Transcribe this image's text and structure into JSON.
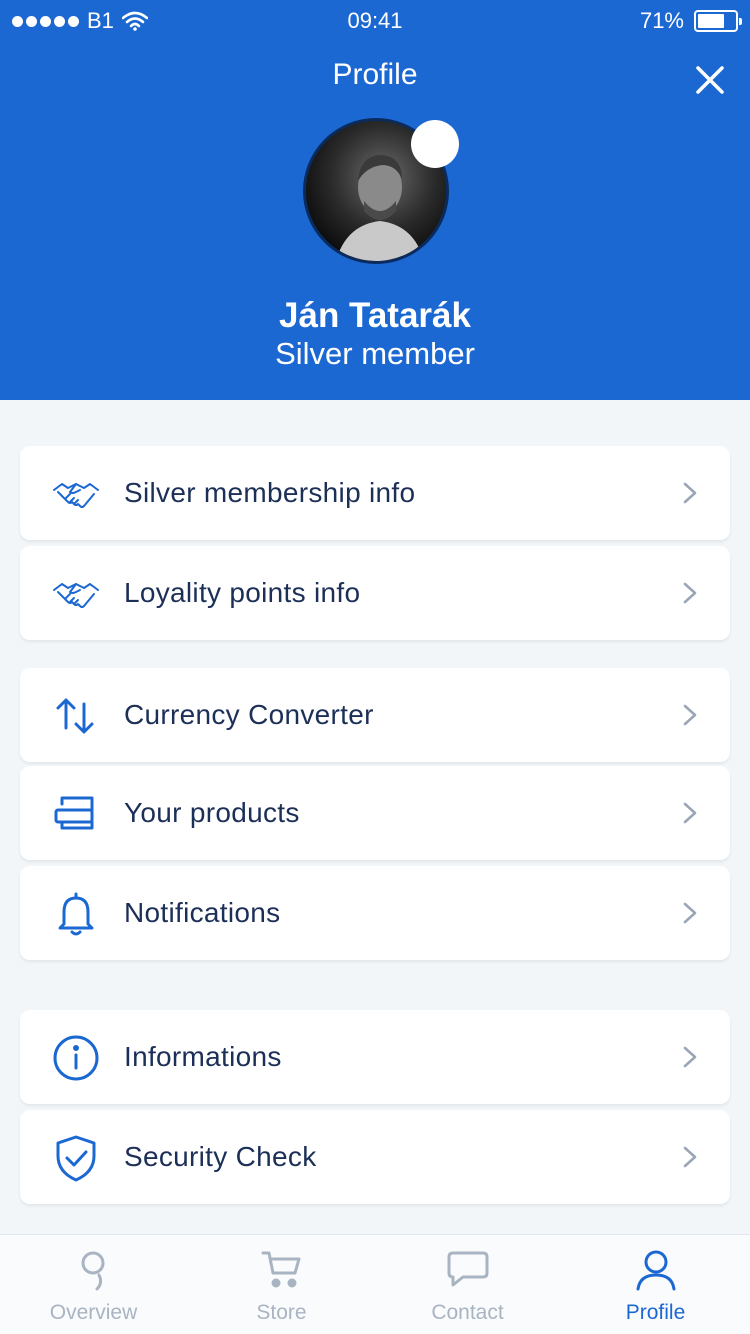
{
  "status_bar": {
    "carrier": "B1",
    "time": "09:41",
    "battery": "71%",
    "battery_level": 0.71
  },
  "header": {
    "title": "Profile",
    "user_name": "Ján Tatarák",
    "membership": "Silver member"
  },
  "menu": {
    "membership_info": "Silver membership info",
    "loyalty_info": "Loyality points info",
    "currency_converter": "Currency  Converter",
    "your_products": "Your products",
    "notifications": "Notifications",
    "informations": "Informations",
    "security_check": "Security Check"
  },
  "tabbar": {
    "overview": "Overview",
    "store": "Store",
    "contact": "Contact",
    "profile": "Profile",
    "active": "profile"
  },
  "colors": {
    "brand": "#1c68d3",
    "text": "#1c2f57",
    "chevron": "#9aa6b6",
    "tab_inactive": "#a9b4c3"
  }
}
